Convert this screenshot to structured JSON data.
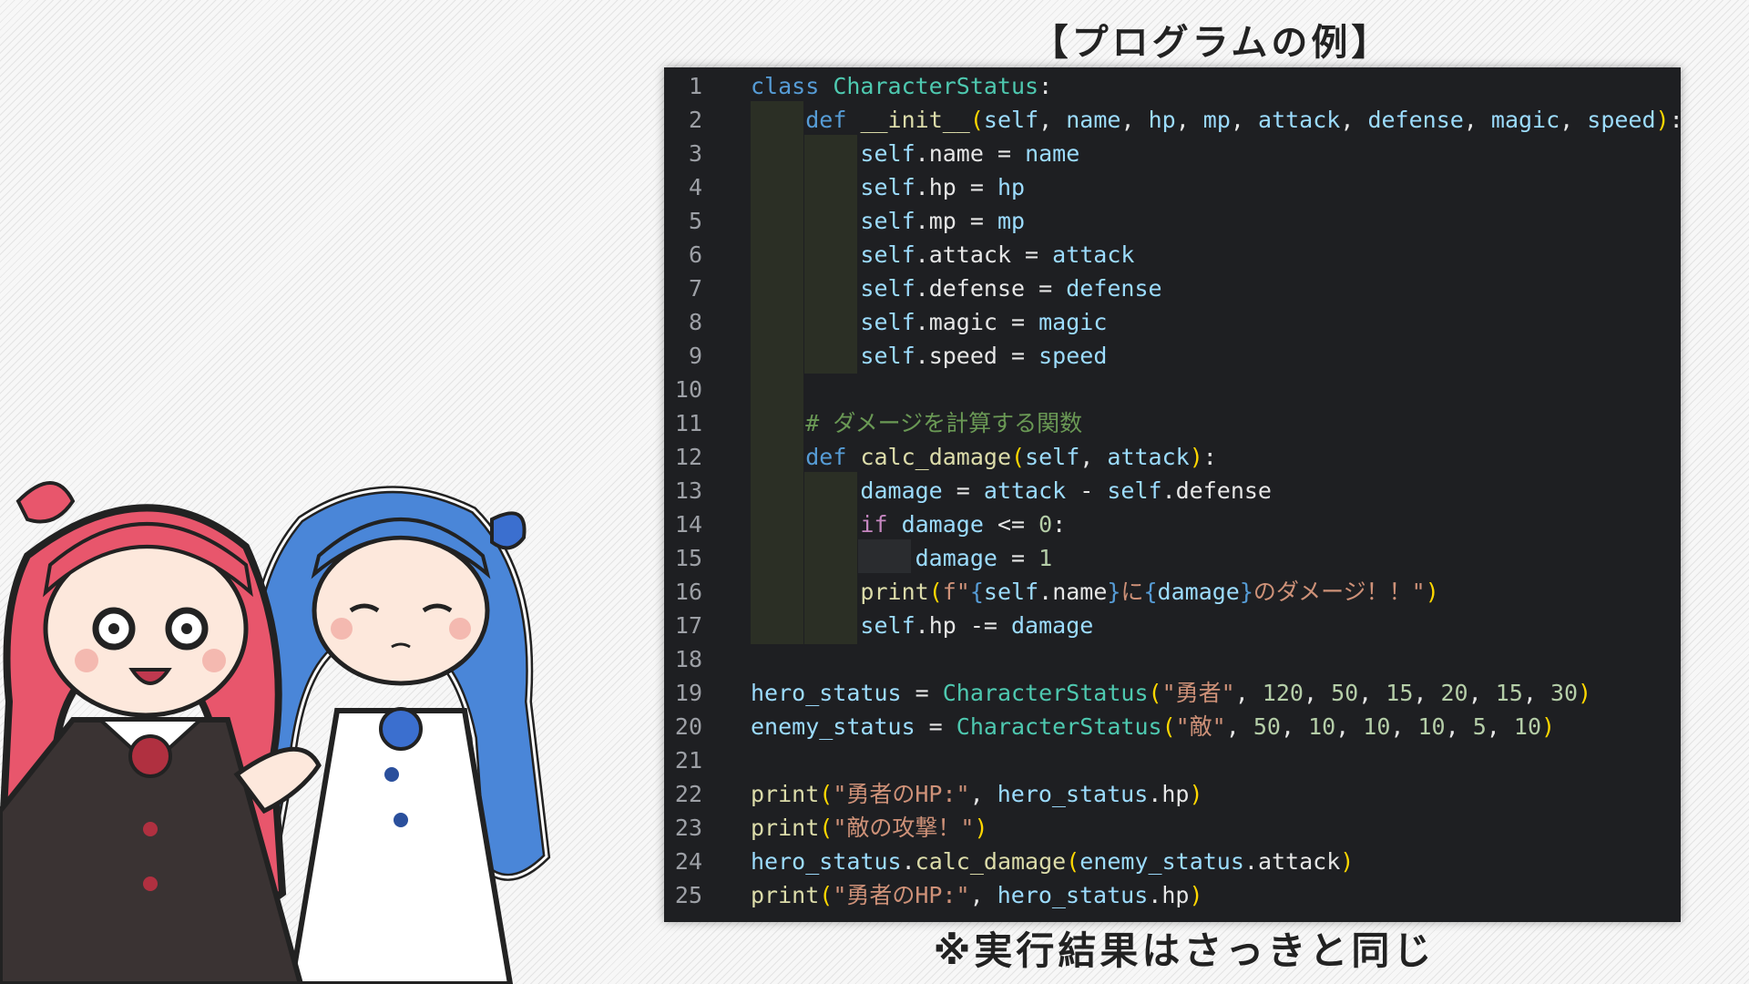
{
  "heading": "【プログラムの例】",
  "footnote": "※実行結果はさっきと同じ",
  "editor": {
    "line_numbers": [
      "1",
      "2",
      "3",
      "4",
      "5",
      "6",
      "7",
      "8",
      "9",
      "10",
      "11",
      "12",
      "13",
      "14",
      "15",
      "16",
      "17",
      "18",
      "19",
      "20",
      "21",
      "22",
      "23",
      "24",
      "25"
    ],
    "lines": [
      [
        {
          "t": "class ",
          "c": "kw"
        },
        {
          "t": "CharacterStatus",
          "c": "cls"
        },
        {
          "t": ":",
          "c": ""
        }
      ],
      [
        {
          "t": "    ",
          "c": ""
        },
        {
          "t": "def ",
          "c": "kw"
        },
        {
          "t": "__init__",
          "c": "fn"
        },
        {
          "t": "(",
          "c": "brk"
        },
        {
          "t": "self",
          "c": "var"
        },
        {
          "t": ", ",
          "c": ""
        },
        {
          "t": "name",
          "c": "var"
        },
        {
          "t": ", ",
          "c": ""
        },
        {
          "t": "hp",
          "c": "var"
        },
        {
          "t": ", ",
          "c": ""
        },
        {
          "t": "mp",
          "c": "var"
        },
        {
          "t": ", ",
          "c": ""
        },
        {
          "t": "attack",
          "c": "var"
        },
        {
          "t": ", ",
          "c": ""
        },
        {
          "t": "defense",
          "c": "var"
        },
        {
          "t": ", ",
          "c": ""
        },
        {
          "t": "magic",
          "c": "var"
        },
        {
          "t": ", ",
          "c": ""
        },
        {
          "t": "speed",
          "c": "var"
        },
        {
          "t": ")",
          "c": "brk"
        },
        {
          "t": ":",
          "c": ""
        }
      ],
      [
        {
          "t": "        ",
          "c": ""
        },
        {
          "t": "self",
          "c": "var"
        },
        {
          "t": ".name = ",
          "c": ""
        },
        {
          "t": "name",
          "c": "var"
        }
      ],
      [
        {
          "t": "        ",
          "c": ""
        },
        {
          "t": "self",
          "c": "var"
        },
        {
          "t": ".hp = ",
          "c": ""
        },
        {
          "t": "hp",
          "c": "var"
        }
      ],
      [
        {
          "t": "        ",
          "c": ""
        },
        {
          "t": "self",
          "c": "var"
        },
        {
          "t": ".mp = ",
          "c": ""
        },
        {
          "t": "mp",
          "c": "var"
        }
      ],
      [
        {
          "t": "        ",
          "c": ""
        },
        {
          "t": "self",
          "c": "var"
        },
        {
          "t": ".attack = ",
          "c": ""
        },
        {
          "t": "attack",
          "c": "var"
        }
      ],
      [
        {
          "t": "        ",
          "c": ""
        },
        {
          "t": "self",
          "c": "var"
        },
        {
          "t": ".defense = ",
          "c": ""
        },
        {
          "t": "defense",
          "c": "var"
        }
      ],
      [
        {
          "t": "        ",
          "c": ""
        },
        {
          "t": "self",
          "c": "var"
        },
        {
          "t": ".magic = ",
          "c": ""
        },
        {
          "t": "magic",
          "c": "var"
        }
      ],
      [
        {
          "t": "        ",
          "c": ""
        },
        {
          "t": "self",
          "c": "var"
        },
        {
          "t": ".speed = ",
          "c": ""
        },
        {
          "t": "speed",
          "c": "var"
        }
      ],
      [],
      [
        {
          "t": "    ",
          "c": ""
        },
        {
          "t": "# ダメージを計算する関数",
          "c": "cm"
        }
      ],
      [
        {
          "t": "    ",
          "c": ""
        },
        {
          "t": "def ",
          "c": "kw"
        },
        {
          "t": "calc_damage",
          "c": "fn"
        },
        {
          "t": "(",
          "c": "brk"
        },
        {
          "t": "self",
          "c": "var"
        },
        {
          "t": ", ",
          "c": ""
        },
        {
          "t": "attack",
          "c": "var"
        },
        {
          "t": ")",
          "c": "brk"
        },
        {
          "t": ":",
          "c": ""
        }
      ],
      [
        {
          "t": "        ",
          "c": ""
        },
        {
          "t": "damage",
          "c": "var"
        },
        {
          "t": " = ",
          "c": ""
        },
        {
          "t": "attack",
          "c": "var"
        },
        {
          "t": " - ",
          "c": ""
        },
        {
          "t": "self",
          "c": "var"
        },
        {
          "t": ".defense",
          "c": ""
        }
      ],
      [
        {
          "t": "        ",
          "c": ""
        },
        {
          "t": "if ",
          "c": "ctrl"
        },
        {
          "t": "damage",
          "c": "var"
        },
        {
          "t": " <= ",
          "c": ""
        },
        {
          "t": "0",
          "c": "num"
        },
        {
          "t": ":",
          "c": ""
        }
      ],
      [
        {
          "t": "            ",
          "c": ""
        },
        {
          "t": "damage",
          "c": "var"
        },
        {
          "t": " = ",
          "c": ""
        },
        {
          "t": "1",
          "c": "num"
        }
      ],
      [
        {
          "t": "        ",
          "c": ""
        },
        {
          "t": "print",
          "c": "fn"
        },
        {
          "t": "(",
          "c": "brk"
        },
        {
          "t": "f\"",
          "c": "str"
        },
        {
          "t": "{",
          "c": "kw"
        },
        {
          "t": "self",
          "c": "var"
        },
        {
          "t": ".name",
          "c": ""
        },
        {
          "t": "}",
          "c": "kw"
        },
        {
          "t": "に",
          "c": "str"
        },
        {
          "t": "{",
          "c": "kw"
        },
        {
          "t": "damage",
          "c": "var"
        },
        {
          "t": "}",
          "c": "kw"
        },
        {
          "t": "のダメージ！！\"",
          "c": "str"
        },
        {
          "t": ")",
          "c": "brk"
        }
      ],
      [
        {
          "t": "        ",
          "c": ""
        },
        {
          "t": "self",
          "c": "var"
        },
        {
          "t": ".hp -= ",
          "c": ""
        },
        {
          "t": "damage",
          "c": "var"
        }
      ],
      [],
      [
        {
          "t": "hero_status",
          "c": "var"
        },
        {
          "t": " = ",
          "c": ""
        },
        {
          "t": "CharacterStatus",
          "c": "cls"
        },
        {
          "t": "(",
          "c": "brk"
        },
        {
          "t": "\"勇者\"",
          "c": "str"
        },
        {
          "t": ", ",
          "c": ""
        },
        {
          "t": "120",
          "c": "num"
        },
        {
          "t": ", ",
          "c": ""
        },
        {
          "t": "50",
          "c": "num"
        },
        {
          "t": ", ",
          "c": ""
        },
        {
          "t": "15",
          "c": "num"
        },
        {
          "t": ", ",
          "c": ""
        },
        {
          "t": "20",
          "c": "num"
        },
        {
          "t": ", ",
          "c": ""
        },
        {
          "t": "15",
          "c": "num"
        },
        {
          "t": ", ",
          "c": ""
        },
        {
          "t": "30",
          "c": "num"
        },
        {
          "t": ")",
          "c": "brk"
        }
      ],
      [
        {
          "t": "enemy_status",
          "c": "var"
        },
        {
          "t": " = ",
          "c": ""
        },
        {
          "t": "CharacterStatus",
          "c": "cls"
        },
        {
          "t": "(",
          "c": "brk"
        },
        {
          "t": "\"敵\"",
          "c": "str"
        },
        {
          "t": ", ",
          "c": ""
        },
        {
          "t": "50",
          "c": "num"
        },
        {
          "t": ", ",
          "c": ""
        },
        {
          "t": "10",
          "c": "num"
        },
        {
          "t": ", ",
          "c": ""
        },
        {
          "t": "10",
          "c": "num"
        },
        {
          "t": ", ",
          "c": ""
        },
        {
          "t": "10",
          "c": "num"
        },
        {
          "t": ", ",
          "c": ""
        },
        {
          "t": "5",
          "c": "num"
        },
        {
          "t": ", ",
          "c": ""
        },
        {
          "t": "10",
          "c": "num"
        },
        {
          "t": ")",
          "c": "brk"
        }
      ],
      [],
      [
        {
          "t": "print",
          "c": "fn"
        },
        {
          "t": "(",
          "c": "brk"
        },
        {
          "t": "\"勇者のHP:\"",
          "c": "str"
        },
        {
          "t": ", ",
          "c": ""
        },
        {
          "t": "hero_status",
          "c": "var"
        },
        {
          "t": ".hp",
          "c": ""
        },
        {
          "t": ")",
          "c": "brk"
        }
      ],
      [
        {
          "t": "print",
          "c": "fn"
        },
        {
          "t": "(",
          "c": "brk"
        },
        {
          "t": "\"敵の攻撃！\"",
          "c": "str"
        },
        {
          "t": ")",
          "c": "brk"
        }
      ],
      [
        {
          "t": "hero_status",
          "c": "var"
        },
        {
          "t": ".",
          "c": ""
        },
        {
          "t": "calc_damage",
          "c": "fn"
        },
        {
          "t": "(",
          "c": "brk"
        },
        {
          "t": "enemy_status",
          "c": "var"
        },
        {
          "t": ".attack",
          "c": ""
        },
        {
          "t": ")",
          "c": "brk"
        }
      ],
      [
        {
          "t": "print",
          "c": "fn"
        },
        {
          "t": "(",
          "c": "brk"
        },
        {
          "t": "\"勇者のHP:\"",
          "c": "str"
        },
        {
          "t": ", ",
          "c": ""
        },
        {
          "t": "hero_status",
          "c": "var"
        },
        {
          "t": ".hp",
          "c": ""
        },
        {
          "t": ")",
          "c": "brk"
        }
      ]
    ]
  },
  "colors": {
    "editor_bg": "#1e1f22",
    "keyword": "#569cd6",
    "class": "#4ec9b0",
    "function": "#dcdcaa",
    "variable": "#9cdcfe",
    "string": "#ce9178",
    "number": "#b5cea8",
    "comment": "#6a9955"
  },
  "illustration": {
    "characters": [
      "pink-haired-girl",
      "blue-haired-girl"
    ]
  }
}
